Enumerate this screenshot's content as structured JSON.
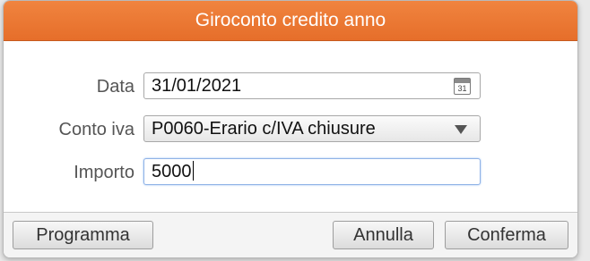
{
  "dialog": {
    "title": "Giroconto credito anno"
  },
  "form": {
    "data_label": "Data",
    "data_value": "31/01/2021",
    "calendar_day": "31",
    "conto_label": "Conto iva",
    "conto_value": "P0060-Erario c/IVA chiusure",
    "importo_label": "Importo",
    "importo_value": "5000"
  },
  "buttons": {
    "programma": "Programma",
    "annulla": "Annulla",
    "conferma": "Conferma"
  },
  "colors": {
    "titlebar": "#e66e2a",
    "title_text": "#ffffff"
  },
  "icons": {
    "date_picker": "calendar-icon",
    "select": "chevron-down-icon"
  }
}
